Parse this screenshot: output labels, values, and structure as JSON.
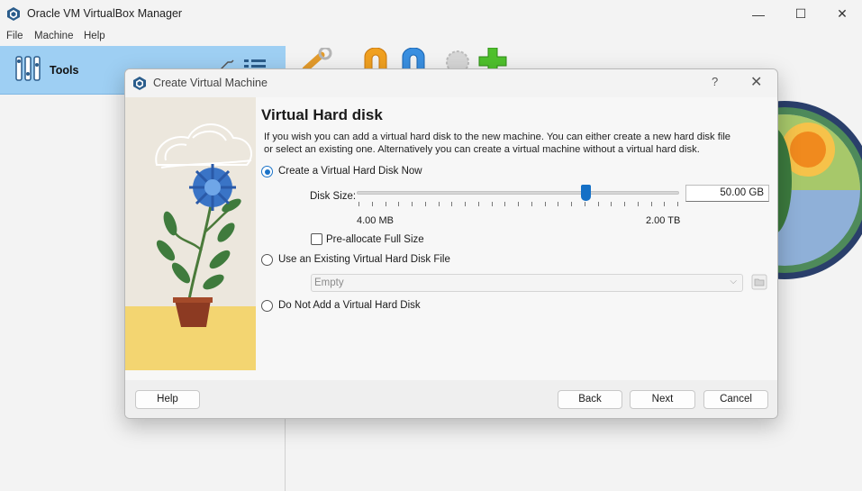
{
  "window": {
    "title": "Oracle VM VirtualBox Manager",
    "controls": {
      "minimize": "—",
      "maximize": "☐",
      "close": "✕"
    }
  },
  "menu": {
    "items": [
      "File",
      "Machine",
      "Help"
    ]
  },
  "sidebar": {
    "tools_label": "Tools"
  },
  "dialog": {
    "title": "Create Virtual Machine",
    "help_glyph": "?",
    "close_glyph": "✕",
    "heading": "Virtual Hard disk",
    "description": "If you wish you can add a virtual hard disk to the new machine. You can either create a new hard disk file or select an existing one. Alternatively you can create a virtual machine without a virtual hard disk.",
    "options": {
      "create_now": {
        "label": "Create a Virtual Hard Disk Now",
        "checked": true
      },
      "use_existing": {
        "label": "Use an Existing Virtual Hard Disk File",
        "checked": false
      },
      "no_disk": {
        "label": "Do Not Add a Virtual Hard Disk",
        "checked": false
      }
    },
    "disk_size": {
      "label": "Disk Size:",
      "value": "50.00 GB",
      "min_label": "4.00 MB",
      "max_label": "2.00 TB",
      "slider_fraction": 0.71
    },
    "preallocate": {
      "label": "Pre-allocate Full Size",
      "checked": false
    },
    "existing_file": {
      "selected": "Empty",
      "enabled": false
    },
    "buttons": {
      "help": "Help",
      "back": "Back",
      "next": "Next",
      "cancel": "Cancel"
    }
  },
  "colors": {
    "accent": "#1570c6",
    "tools_highlight": "#9ecff3"
  }
}
